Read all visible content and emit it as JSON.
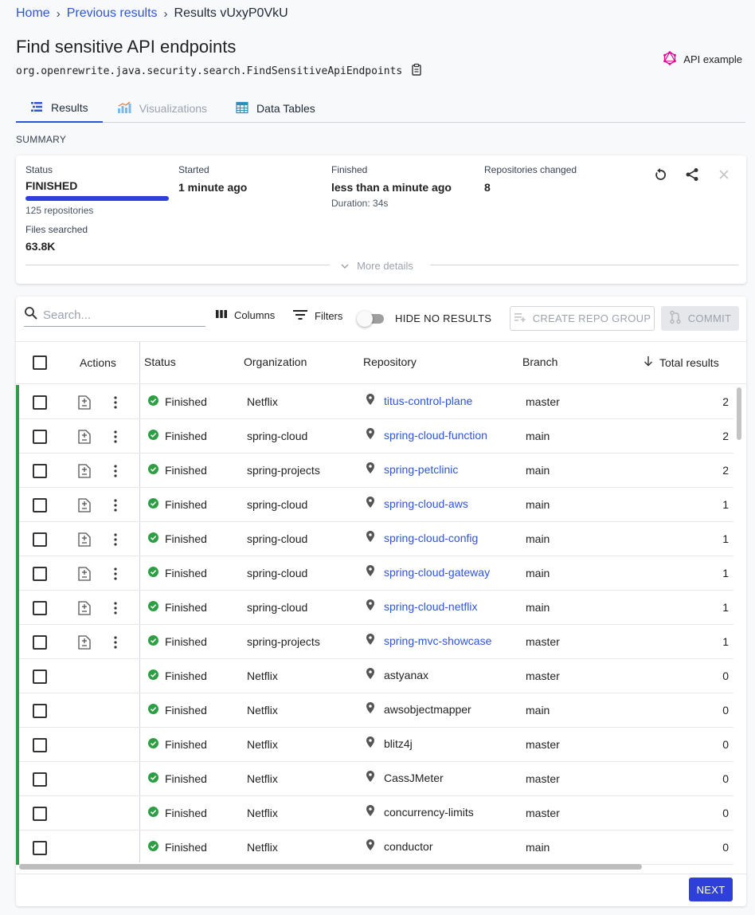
{
  "breadcrumb": {
    "home": "Home",
    "previous": "Previous results",
    "current": "Results vUxyP0VkU"
  },
  "page": {
    "title": "Find sensitive API endpoints",
    "recipe_id": "org.openrewrite.java.security.search.FindSensitiveApiEndpoints",
    "api_example": "API example"
  },
  "tabs": [
    {
      "label": "Results",
      "icon": "list-icon",
      "state": "active"
    },
    {
      "label": "Visualizations",
      "icon": "bar-chart-icon",
      "state": "disabled"
    },
    {
      "label": "Data Tables",
      "icon": "table-icon",
      "state": "normal"
    }
  ],
  "summary": {
    "section_label": "SUMMARY",
    "status_label": "Status",
    "status_value": "FINISHED",
    "repositories_count": "125 repositories",
    "progress": 1.0,
    "started_label": "Started",
    "started_value": "1 minute ago",
    "finished_label": "Finished",
    "finished_value": "less than a minute ago",
    "duration": "Duration: 34s",
    "changed_label": "Repositories changed",
    "changed_value": "8",
    "files_label": "Files searched",
    "files_value": "63.8K",
    "more_details": "More details"
  },
  "toolbar": {
    "search_placeholder": "Search...",
    "columns": "Columns",
    "filters": "Filters",
    "hide_no_results": "HIDE NO RESULTS",
    "hide_no_results_on": false,
    "create_repo_group": "CREATE REPO GROUP",
    "commit": "COMMIT"
  },
  "columns": {
    "actions": "Actions",
    "status": "Status",
    "organization": "Organization",
    "repository": "Repository",
    "branch": "Branch",
    "total_results": "Total results"
  },
  "rows": [
    {
      "status": "Finished",
      "organization": "Netflix",
      "repository": "titus-control-plane",
      "branch": "master",
      "total": "2",
      "has_changes": true
    },
    {
      "status": "Finished",
      "organization": "spring-cloud",
      "repository": "spring-cloud-function",
      "branch": "main",
      "total": "2",
      "has_changes": true
    },
    {
      "status": "Finished",
      "organization": "spring-projects",
      "repository": "spring-petclinic",
      "branch": "main",
      "total": "2",
      "has_changes": true
    },
    {
      "status": "Finished",
      "organization": "spring-cloud",
      "repository": "spring-cloud-aws",
      "branch": "main",
      "total": "1",
      "has_changes": true
    },
    {
      "status": "Finished",
      "organization": "spring-cloud",
      "repository": "spring-cloud-config",
      "branch": "main",
      "total": "1",
      "has_changes": true
    },
    {
      "status": "Finished",
      "organization": "spring-cloud",
      "repository": "spring-cloud-gateway",
      "branch": "main",
      "total": "1",
      "has_changes": true
    },
    {
      "status": "Finished",
      "organization": "spring-cloud",
      "repository": "spring-cloud-netflix",
      "branch": "main",
      "total": "1",
      "has_changes": true
    },
    {
      "status": "Finished",
      "organization": "spring-projects",
      "repository": "spring-mvc-showcase",
      "branch": "master",
      "total": "1",
      "has_changes": true
    },
    {
      "status": "Finished",
      "organization": "Netflix",
      "repository": "astyanax",
      "branch": "master",
      "total": "0",
      "has_changes": false
    },
    {
      "status": "Finished",
      "organization": "Netflix",
      "repository": "awsobjectmapper",
      "branch": "main",
      "total": "0",
      "has_changes": false
    },
    {
      "status": "Finished",
      "organization": "Netflix",
      "repository": "blitz4j",
      "branch": "master",
      "total": "0",
      "has_changes": false
    },
    {
      "status": "Finished",
      "organization": "Netflix",
      "repository": "CassJMeter",
      "branch": "master",
      "total": "0",
      "has_changes": false
    },
    {
      "status": "Finished",
      "organization": "Netflix",
      "repository": "concurrency-limits",
      "branch": "master",
      "total": "0",
      "has_changes": false
    },
    {
      "status": "Finished",
      "organization": "Netflix",
      "repository": "conductor",
      "branch": "main",
      "total": "0",
      "has_changes": false
    }
  ],
  "pagination": {
    "next": "NEXT"
  },
  "colors": {
    "link": "#2f55d4",
    "primary": "#2f3fd9",
    "success": "#2e9e44",
    "api_icon": "#e10098"
  }
}
